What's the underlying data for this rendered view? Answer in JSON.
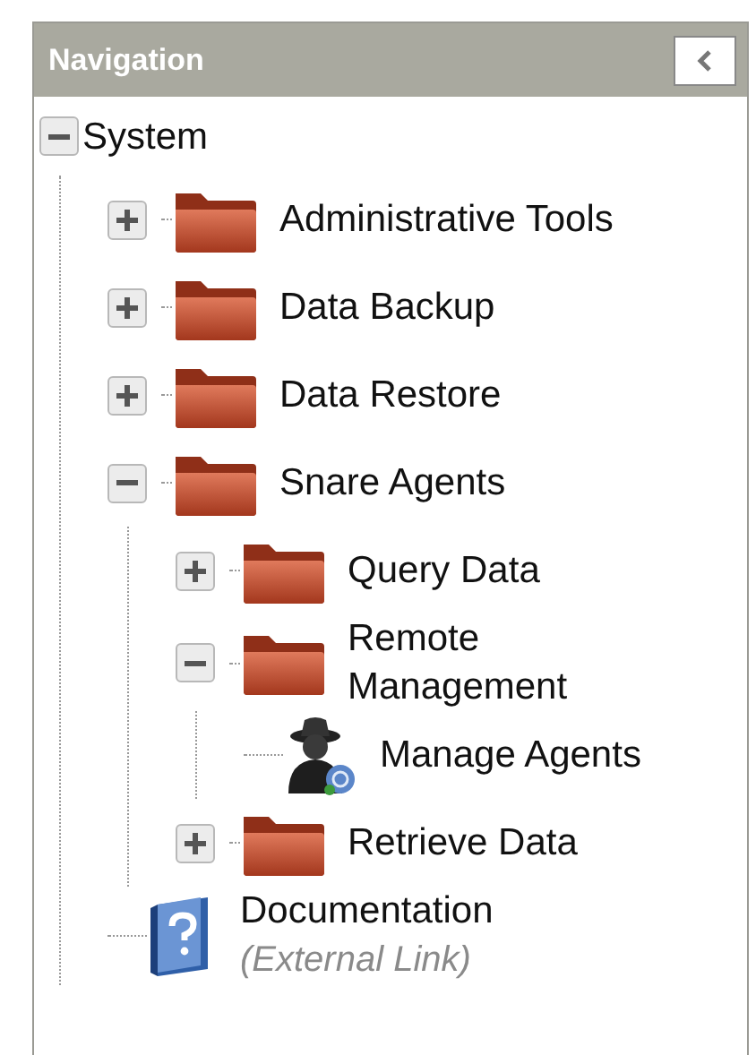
{
  "panel": {
    "title": "Navigation"
  },
  "tree": [
    {
      "label": "System",
      "kind": "root",
      "expanded": true,
      "children": [
        {
          "label": "Administrative Tools",
          "kind": "folder",
          "expanded": false
        },
        {
          "label": "Data Backup",
          "kind": "folder",
          "expanded": false
        },
        {
          "label": "Data Restore",
          "kind": "folder",
          "expanded": false
        },
        {
          "label": "Snare Agents",
          "kind": "folder",
          "expanded": true,
          "children": [
            {
              "label": "Query Data",
              "kind": "folder",
              "expanded": false
            },
            {
              "label": "Remote Management",
              "kind": "folder",
              "expanded": true,
              "children": [
                {
                  "label": "Manage Agents",
                  "kind": "agent"
                }
              ]
            },
            {
              "label": "Retrieve Data",
              "kind": "folder",
              "expanded": false
            }
          ]
        },
        {
          "label": "Documentation",
          "kind": "document",
          "note": "(External Link)"
        }
      ]
    }
  ]
}
